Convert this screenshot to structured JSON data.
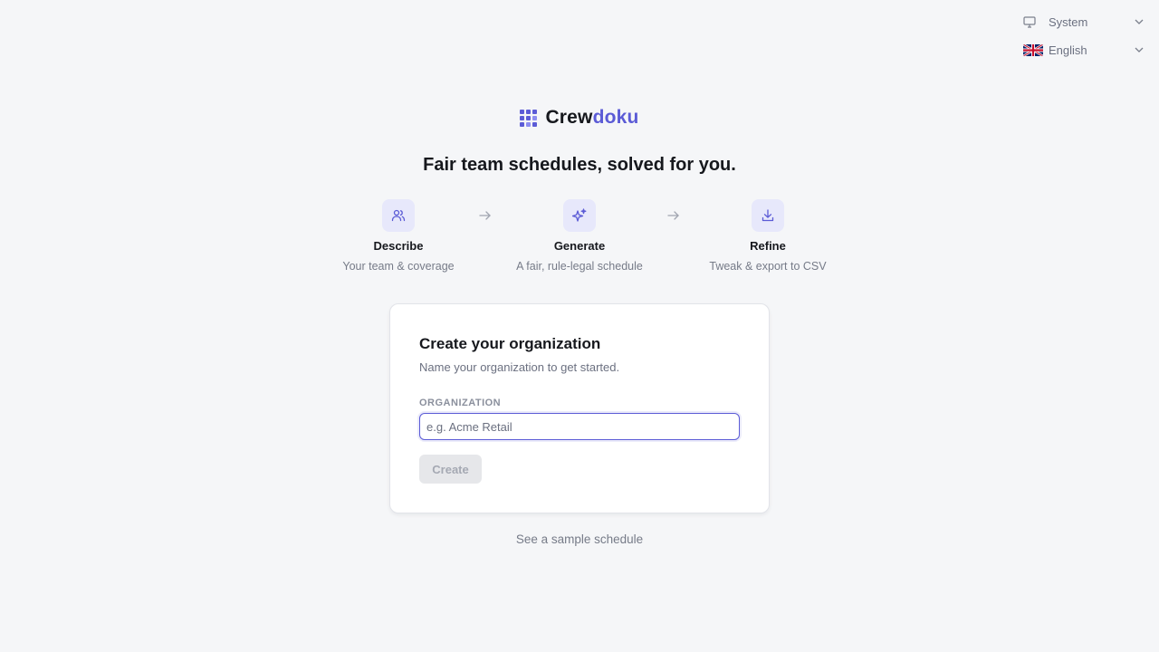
{
  "top_controls": {
    "theme": {
      "label": "System",
      "icon": "monitor-icon"
    },
    "language": {
      "label": "English",
      "icon": "uk-flag-icon"
    }
  },
  "brand": {
    "name_part1": "Crew",
    "name_part2": "doku",
    "accent_color": "#5b5bd6"
  },
  "tagline": "Fair team schedules, solved for you.",
  "steps": [
    {
      "icon": "users-icon",
      "title": "Describe",
      "desc": "Your team & coverage"
    },
    {
      "icon": "sparkles-icon",
      "title": "Generate",
      "desc": "A fair, rule-legal schedule"
    },
    {
      "icon": "download-icon",
      "title": "Refine",
      "desc": "Tweak & export to CSV"
    }
  ],
  "card": {
    "title": "Create your organization",
    "subtitle": "Name your organization to get started.",
    "field_label": "ORGANIZATION",
    "field_value": "",
    "field_placeholder": "e.g. Acme Retail",
    "button_label": "Create"
  },
  "sample_link": "See a sample schedule"
}
